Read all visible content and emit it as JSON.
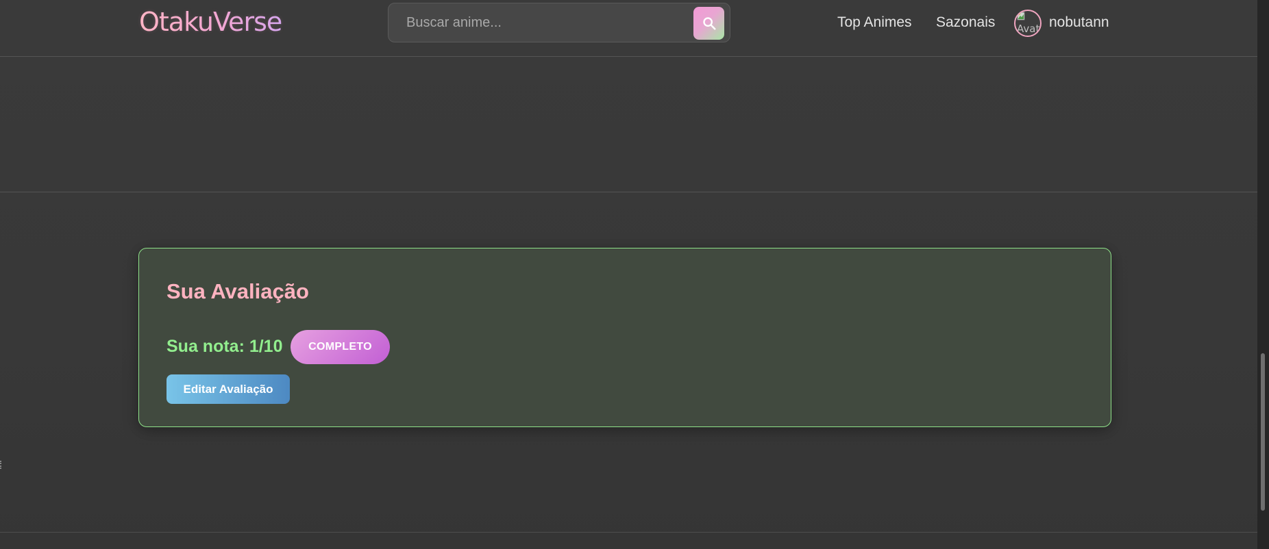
{
  "header": {
    "logo": "OtakuVerse",
    "search": {
      "placeholder": "Buscar anime...",
      "value": "",
      "button_icon": "search-icon"
    },
    "nav": [
      {
        "label": "Top Animes"
      },
      {
        "label": "Sazonais"
      }
    ],
    "user": {
      "username": "nobutann",
      "avatar_alt": "Avatar",
      "avatar_icon": "broken-image-icon"
    }
  },
  "rating_card": {
    "title": "Sua Avaliação",
    "score_text": "Sua nota: 1/10",
    "score": {
      "value": 1,
      "max": 10
    },
    "status": "COMPLETO",
    "edit_label": "Editar Avaliação"
  },
  "colors": {
    "background": "#393939",
    "logo_pink": "#ffb7c5",
    "title_pink": "#ffb3c0",
    "score_green": "#92ee8e",
    "card_border": "#8fe38a",
    "badge_purple": "#c25fd4",
    "button_blue": "#4d89c2"
  },
  "scrollbar": {
    "position_fraction": 0.85
  }
}
